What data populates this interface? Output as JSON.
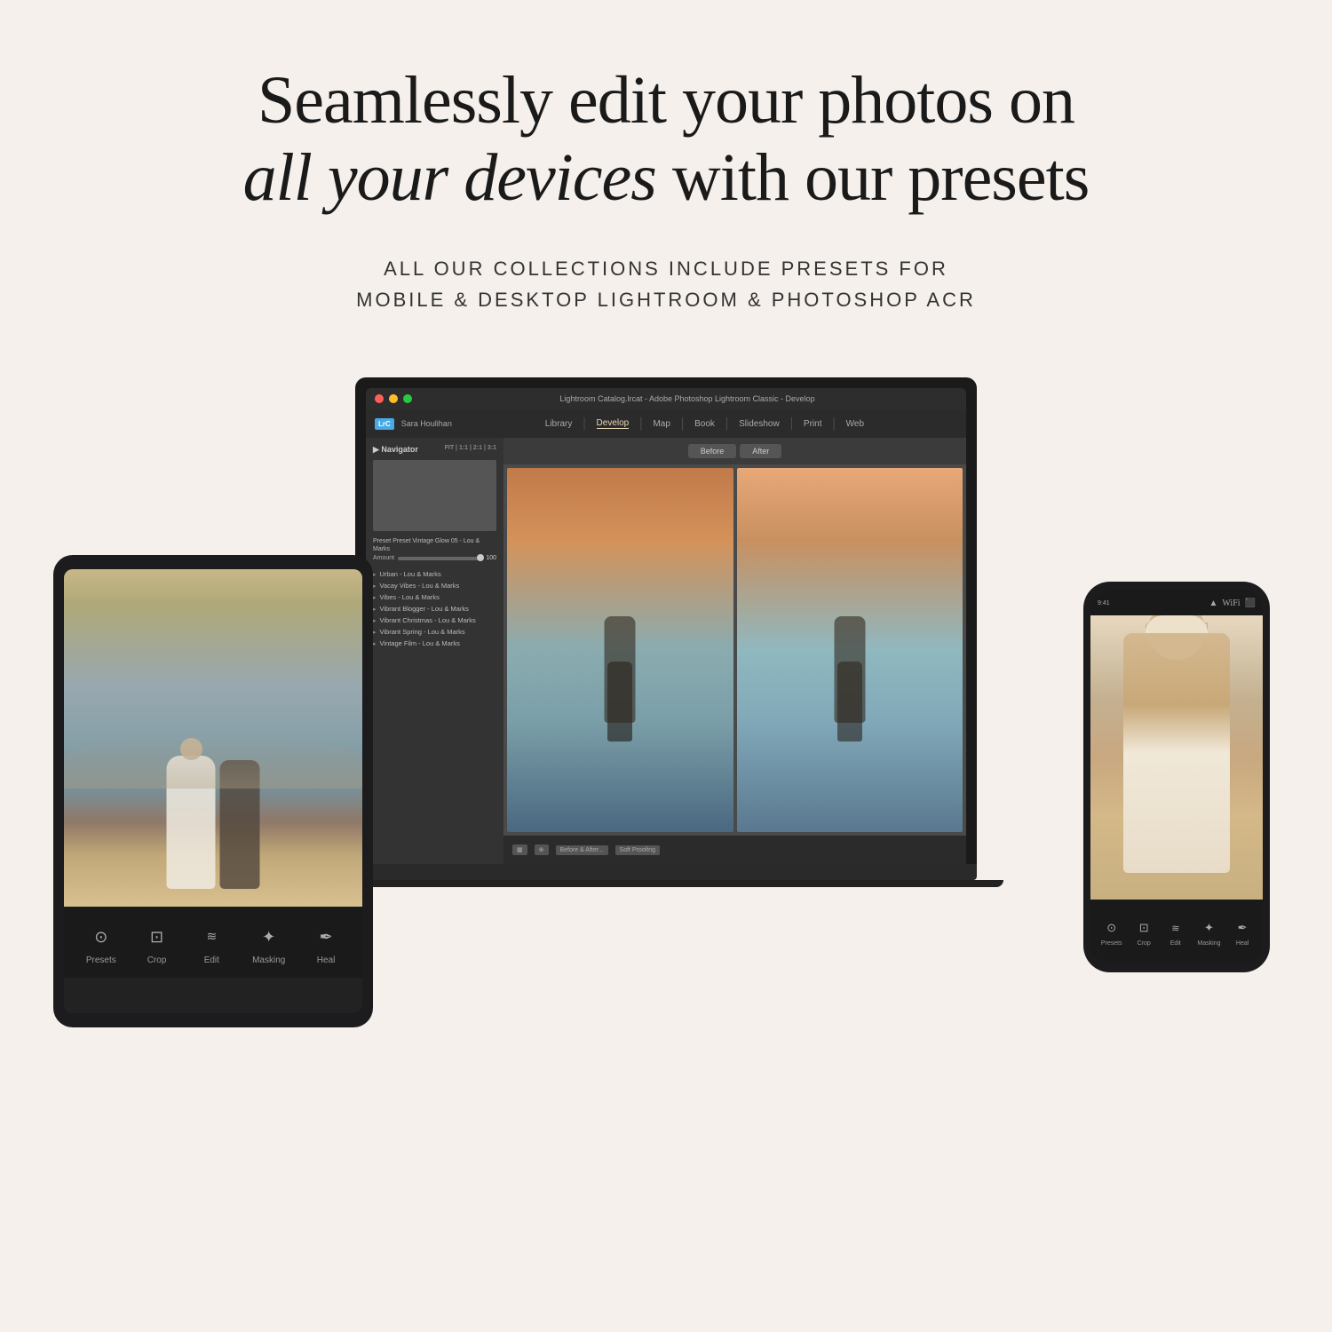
{
  "page": {
    "background_color": "#f5f0eb"
  },
  "headline": {
    "line1": "Seamlessly edit your photos on",
    "line2_italic": "all your devices",
    "line2_normal": " with our presets"
  },
  "subheadline": {
    "line1": "ALL OUR COLLECTIONS INCLUDE PRESETS FOR",
    "line2": "MOBILE & DESKTOP LIGHTROOM & PHOTOSHOP ACR"
  },
  "laptop": {
    "titlebar_text": "Lightroom Catalog.lrcat - Adobe Photoshop Lightroom Classic - Develop",
    "logo": "LrC",
    "user": "Sara Houlihan",
    "nav_items": [
      "Library",
      "Develop",
      "Map",
      "Book",
      "Slideshow",
      "Print",
      "Web"
    ],
    "active_nav": "Develop",
    "sidebar_title": "Navigator",
    "preset_label": "Preset  Vintage Glow 05 - Lou & Marks",
    "amount_label": "Amount",
    "preset_amount": "100",
    "preset_items": [
      "Urban - Lou & Marks",
      "Vacay Vibes - Lou & Marks",
      "Vibes - Lou & Marks",
      "Vibrant Blogger - Lou & Marks",
      "Vibrant Christmas - Lou & Marks",
      "Vibrant Spring - Lou & Marks",
      "Vintage Film - Lou & Marks"
    ],
    "before_label": "Before",
    "after_label": "After",
    "bottom_btn": "Before & After..."
  },
  "tablet": {
    "tools": [
      {
        "label": "Presets",
        "icon": "⊙"
      },
      {
        "label": "Crop",
        "icon": "⊡"
      },
      {
        "label": "Edit",
        "icon": "⧖"
      },
      {
        "label": "Masking",
        "icon": "✦"
      },
      {
        "label": "Heal",
        "icon": "⌇"
      }
    ]
  },
  "phone": {
    "tools": [
      {
        "label": "Presets",
        "icon": "⊙"
      },
      {
        "label": "Crop",
        "icon": "⊡"
      },
      {
        "label": "Edit",
        "icon": "⧖"
      },
      {
        "label": "Masking",
        "icon": "✦"
      },
      {
        "label": "Heal",
        "icon": "⌇"
      }
    ]
  }
}
